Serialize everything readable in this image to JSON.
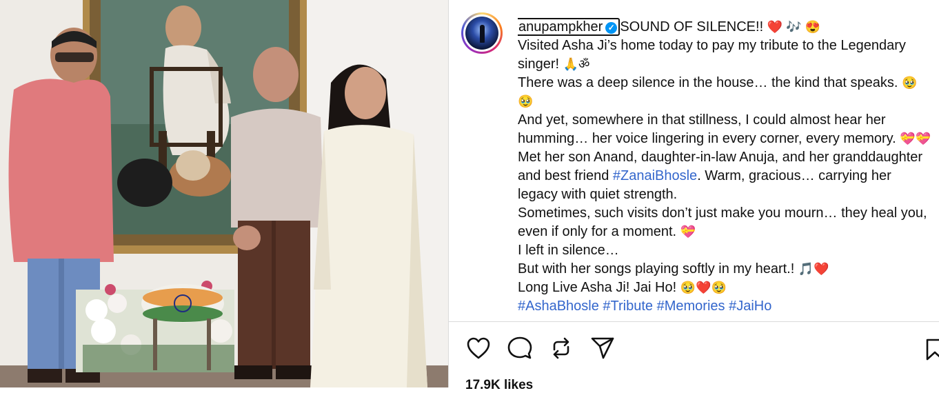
{
  "post": {
    "username": "anupampkher",
    "verified_mark": "✓",
    "headline": "SOUND OF SILENCE!!",
    "headline_emoji": "❤️ 🎶 😍",
    "lines": [
      {
        "text": "Visited Asha Ji’s home today to pay my tribute to the Legendary singer!",
        "emoji": "🙏ॐ"
      },
      {
        "text": "There was a deep silence in the house… the kind that speaks.",
        "emoji": "🥹🥹"
      },
      {
        "text": "And yet, somewhere in that stillness, I could almost hear her humming… her voice lingering in every corner, every memory.",
        "emoji": "💝💝"
      }
    ],
    "para_met_before": "Met her son Anand, daughter-in-law Anuja, and her granddaughter and best friend ",
    "hashtag_zanai": "#ZanaiBhosle",
    "para_met_after": ". Warm, gracious… carrying her legacy with quiet strength.",
    "line_visits": "Sometimes, such visits don’t just make you mourn… they heal you, even if only for a moment.",
    "line_visits_emoji": "💝",
    "line_silence": "I left in silence…",
    "line_songs": "But with her songs playing softly in my heart.!",
    "line_songs_emoji": "🎵❤️",
    "line_long_live": "Long Live Asha Ji! Jai Ho!",
    "line_long_live_emoji": "🥹❤️🥹",
    "hashtags_cut": "#AshaBhosle #Tribute #Memories #JaiHo"
  },
  "likes": "17.9K likes",
  "icons": {
    "like": "heart-icon",
    "comment": "comment-icon",
    "repost": "repost-icon",
    "share": "send-icon",
    "save": "bookmark-icon"
  },
  "colors": {
    "hashtag": "#3366cc",
    "verified": "#0095f6",
    "divider": "#dbdbdb"
  }
}
